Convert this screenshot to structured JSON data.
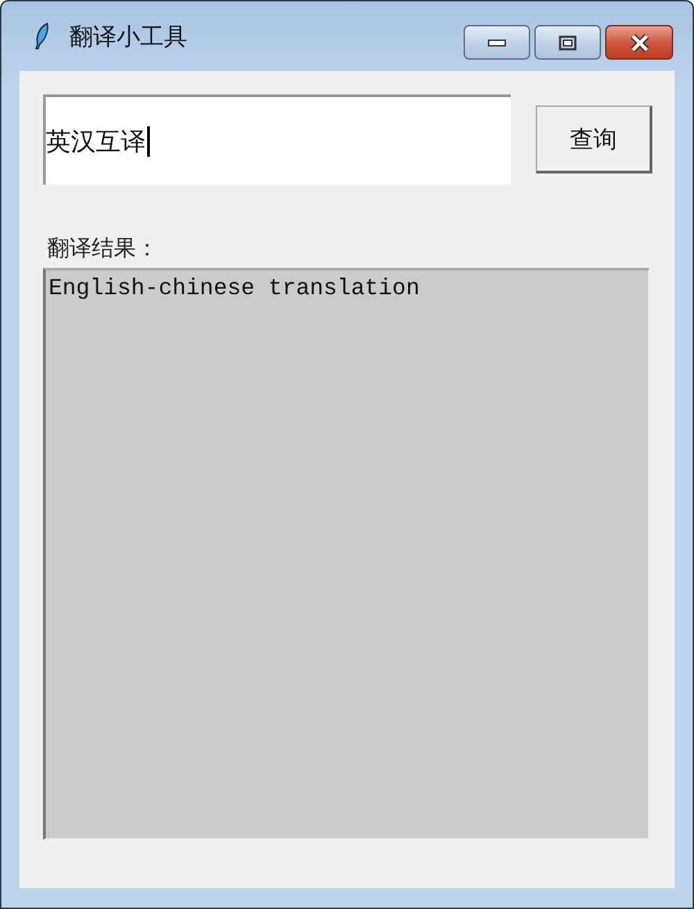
{
  "window": {
    "title": "翻译小工具"
  },
  "query": {
    "value": "英汉互译",
    "focused": true
  },
  "search_button": {
    "label": "查询"
  },
  "result": {
    "label": "翻译结果：",
    "text": "English-chinese translation"
  }
}
